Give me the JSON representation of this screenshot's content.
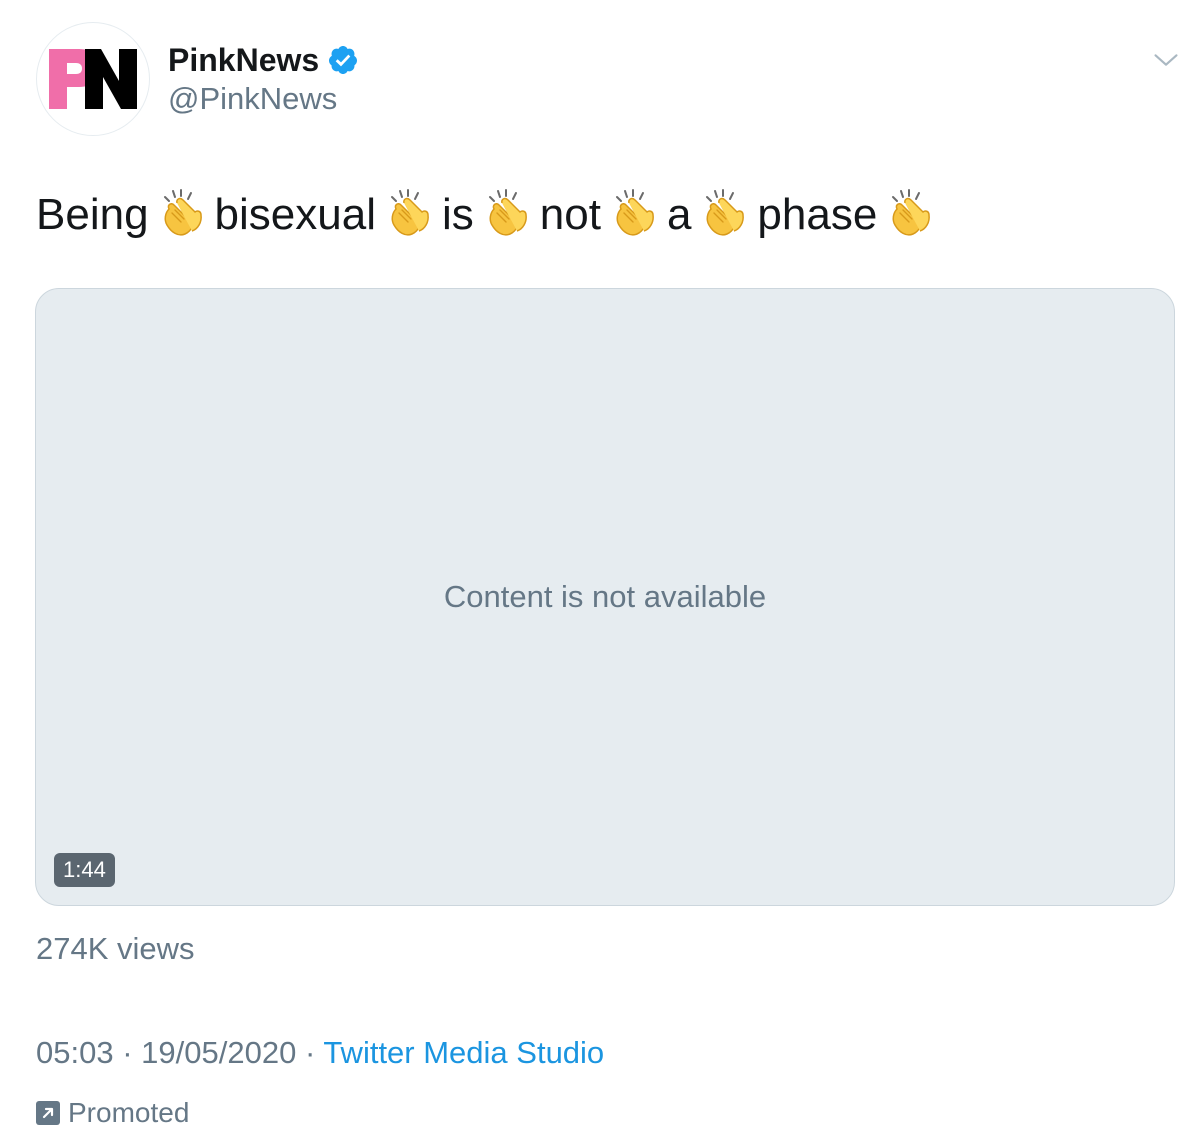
{
  "author": {
    "display_name": "PinkNews",
    "handle": "@PinkNews",
    "avatar_logo": "PN",
    "verified": true,
    "brand_colors": {
      "pink": "#f06ea9",
      "black": "#000000"
    }
  },
  "tweet": {
    "words": [
      "Being",
      "bisexual",
      "is",
      "not",
      "a",
      "phase"
    ],
    "emoji": "clapping-hands-icon"
  },
  "media": {
    "message": "Content is not available",
    "duration": "1:44"
  },
  "stats": {
    "views": "274K views"
  },
  "meta": {
    "time": "05:03",
    "separator": "·",
    "date": "19/05/2020",
    "source": "Twitter Media Studio"
  },
  "promoted": {
    "label": "Promoted",
    "icon": "promoted-arrow-icon"
  },
  "colors": {
    "text": "#14171a",
    "secondary": "#657786",
    "link": "#1b95e0",
    "verified": "#1da1f2",
    "media_bg": "#e6ecf0"
  }
}
